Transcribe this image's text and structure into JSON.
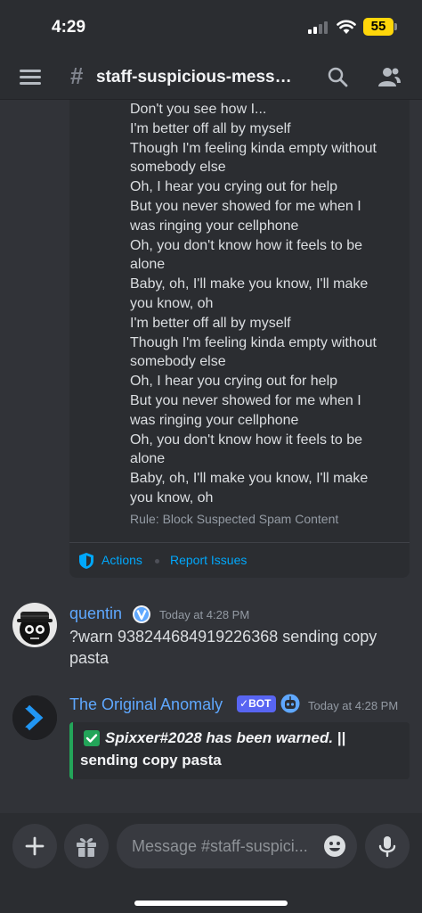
{
  "status_bar": {
    "time": "4:29",
    "battery": "55"
  },
  "header": {
    "channel_name": "staff-suspicious-messag..."
  },
  "automod_embed": {
    "lines": [
      "Don't you see how I...",
      "I'm better off all by myself",
      "Though I'm feeling kinda empty without",
      "somebody else",
      "Oh, I hear you crying out for help",
      "But you never showed for me when I",
      "was ringing your cellphone",
      "Oh, you don't know how it feels to be",
      "alone",
      "Baby, oh, I'll make you know, I'll make",
      "you know, oh",
      "I'm better off all by myself",
      "Though I'm feeling kinda empty without",
      "somebody else",
      "Oh, I hear you crying out for help",
      "But you never showed for me when I",
      "was ringing your cellphone",
      "Oh, you don't know how it feels to be",
      "alone",
      "Baby, oh, I'll make you know, I'll make",
      "you know, oh"
    ],
    "rule": "Rule: Block Suspected Spam Content",
    "actions_label": "Actions",
    "report_label": "Report Issues"
  },
  "messages": [
    {
      "author": "quentin",
      "timestamp": "Today at 4:28 PM",
      "text_line1": "?warn 938244684919226368 sending copy",
      "text_line2": "pasta",
      "author_color": "#5fa8ff",
      "badge_icon": "verified-icon"
    },
    {
      "author": "The Original Anomaly",
      "bot_label": "BOT",
      "timestamp": "Today at 4:28 PM",
      "author_color": "#5fa8ff",
      "embed": {
        "bold_text": "Spixxer#2028 has been warned.",
        "separator": "||",
        "reason": "sending copy pasta",
        "accent": "#23a559"
      }
    }
  ],
  "composer": {
    "placeholder": "Message #staff-suspici..."
  },
  "colors": {
    "background": "#313338",
    "panel": "#2b2d31",
    "link": "#00a8fc",
    "bot_badge": "#5865f2"
  }
}
